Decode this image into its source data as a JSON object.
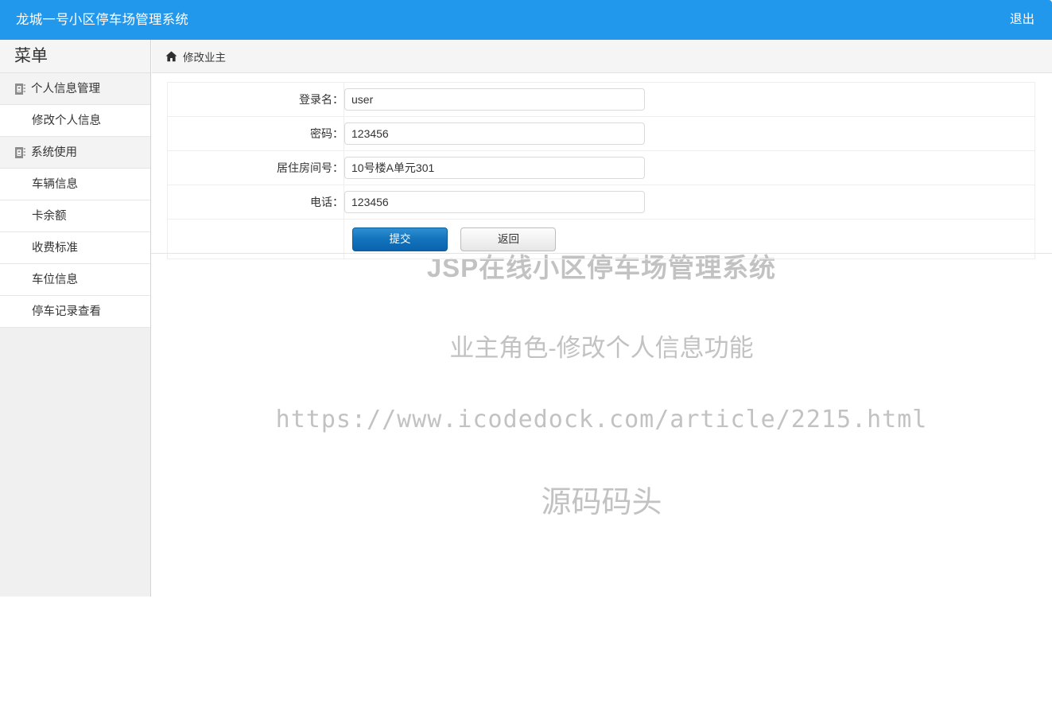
{
  "navbar": {
    "brand": "龙城一号小区停车场管理系统",
    "logout_label": "退出",
    "background_color": "#2298ec"
  },
  "sidebar": {
    "title": "菜单",
    "items": [
      {
        "label": "个人信息管理",
        "type": "group",
        "icon": "book-icon"
      },
      {
        "label": "修改个人信息",
        "type": "item"
      },
      {
        "label": "系统使用",
        "type": "group",
        "icon": "book-icon"
      },
      {
        "label": "车辆信息",
        "type": "item"
      },
      {
        "label": "卡余额",
        "type": "item"
      },
      {
        "label": "收费标准",
        "type": "item"
      },
      {
        "label": "车位信息",
        "type": "item"
      },
      {
        "label": "停车记录查看",
        "type": "item"
      }
    ]
  },
  "breadcrumb": {
    "icon": "home-icon",
    "text": "修改业主"
  },
  "form": {
    "fields": [
      {
        "label": "登录名：",
        "value": "user",
        "name": "login-name"
      },
      {
        "label": "密码：",
        "value": "123456",
        "name": "password"
      },
      {
        "label": "居住房间号：",
        "value": "10号楼A单元301",
        "name": "room-number"
      },
      {
        "label": "电话：",
        "value": "123456",
        "name": "phone"
      }
    ],
    "submit_label": "提交",
    "back_label": "返回",
    "submit_color": "#1475bd"
  },
  "watermark": {
    "line1": "JSP在线小区停车场管理系统",
    "line2": "业主角色-修改个人信息功能",
    "line3": "https://www.icodedock.com/article/2215.html",
    "line4": "源码码头",
    "color": "#c2c2c2"
  }
}
